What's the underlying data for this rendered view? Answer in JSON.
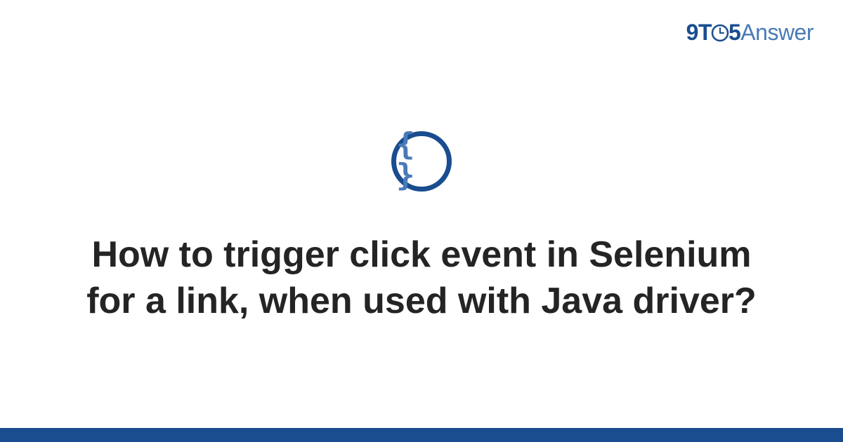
{
  "logo": {
    "prefix": "9T",
    "middle": "5",
    "suffix": "Answer"
  },
  "badge": {
    "symbol": "{ }"
  },
  "title": "How to trigger click event in Selenium for a link, when used with Java driver?",
  "colors": {
    "brand_dark": "#1a4d8f",
    "brand_light": "#4a7ab8",
    "text": "#242424"
  }
}
